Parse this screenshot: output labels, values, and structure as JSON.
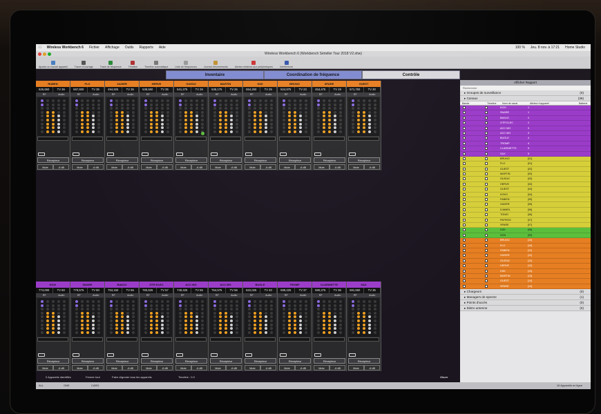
{
  "menubar": {
    "app": "Wireless Workbench 6",
    "items": [
      "Fichier",
      "Affichage",
      "Outils",
      "Rapports",
      "Aide"
    ],
    "clock": "Jeu. 8 nov. à 17:21",
    "battery": "100 %",
    "user": "Home Studio"
  },
  "window": {
    "title": "Wireless Workbench 6 (Workbench Sérieller Tour 2018 V2.shw)"
  },
  "toolbar": [
    {
      "label": "Ajouter un nouvel appareil",
      "color": "#4a7fc0"
    },
    {
      "label": "Tracer d'ouvrage",
      "color": "#555"
    },
    {
      "label": "Tracé de fréquence",
      "color": "#2a8a3a"
    },
    {
      "label": "Timeline",
      "color": "#b03030"
    },
    {
      "label": "Timeline automatique",
      "color": "#777"
    },
    {
      "label": "Liste de fréquences",
      "color": "#999"
    },
    {
      "label": "Journal d'événements",
      "color": "#c09030"
    },
    {
      "label": "Alertes relatives aux périphériques",
      "color": "#cc3333"
    },
    {
      "label": "Interférence",
      "color": "#3355aa"
    }
  ],
  "tabs": [
    {
      "label": "Inventaire",
      "color": "#7f8ad0"
    },
    {
      "label": "Coordination de fréquence",
      "color": "#7f8ad0"
    },
    {
      "label": "Contrôle",
      "color": "#d8d8dc"
    }
  ],
  "colors": {
    "orange": "#e67e22",
    "purple": "#9b3cc9",
    "yellow": "#d6cf3a",
    "green": "#5cbf3c",
    "amber": "#f0a020"
  },
  "top_bank": [
    {
      "name": "RUBEN",
      "freq": "626,650",
      "tv": "TV 36"
    },
    {
      "name": "FLO",
      "freq": "587,600",
      "tv": "TV 35"
    },
    {
      "name": "XAVIER",
      "freq": "494,925",
      "tv": "TV 35"
    },
    {
      "name": "HERVE",
      "freq": "538,550",
      "tv": "TV 35"
    },
    {
      "name": "GUIGUI",
      "freq": "541,275",
      "tv": "TV 26"
    },
    {
      "name": "MARTIN",
      "freq": "536,175",
      "tv": "TV 25"
    },
    {
      "name": "DIDI",
      "freq": "554,250",
      "tv": "TV 25"
    },
    {
      "name": "BRUNO",
      "freq": "524,975",
      "tv": "TV 23"
    },
    {
      "name": "SPARE",
      "freq": "454,475",
      "tv": "TV 19"
    },
    {
      "name": "GUEST",
      "freq": "571,750",
      "tv": "TV 30"
    }
  ],
  "bottom_bank": [
    {
      "name": "KICK",
      "freq": "774,000",
      "tv": "TV 60"
    },
    {
      "name": "SNARE",
      "freq": "778,575",
      "tv": "TV 60"
    },
    {
      "name": "BANJO",
      "freq": "753,150",
      "tv": "TV 56"
    },
    {
      "name": "GTR ELEC",
      "freq": "760,625",
      "tv": "TV 57"
    },
    {
      "name": "ACC MG",
      "freq": "749,425",
      "tv": "TV 55"
    },
    {
      "name": "ACC MG",
      "freq": "754,575",
      "tv": "TV 56"
    },
    {
      "name": "BUGLE",
      "freq": "622,025",
      "tv": "TV 40"
    },
    {
      "name": "TROMP",
      "freq": "599,225",
      "tv": "TV 37"
    },
    {
      "name": "CLARINETTE",
      "freq": "590,275",
      "tv": "TV 36"
    },
    {
      "name": "SAX",
      "freq": "581,550",
      "tv": "TV 35"
    }
  ],
  "channel_labels": {
    "rf": "RF",
    "audio": "Audio",
    "receiver": "Récepteur",
    "mute": "Mute",
    "gain": "-6 dB"
  },
  "right_panel": {
    "title": "Afficher Rapport",
    "search": "Rechercher",
    "groups_top": [
      {
        "label": "Groupes de surveillance",
        "count": "(0)"
      },
      {
        "label": "Canaux",
        "count": "(36)"
      }
    ],
    "columns": [
      "Bande",
      "Timeline",
      "Nom de canal",
      "Attribut d'appareil",
      "Batterie"
    ],
    "rows": [
      {
        "name": "KICK",
        "group": "1",
        "color": "purple"
      },
      {
        "name": "SNARE",
        "group": "1",
        "color": "purple"
      },
      {
        "name": "BANJO",
        "group": "2",
        "color": "purple"
      },
      {
        "name": "GTR ELEC",
        "group": "2",
        "color": "purple"
      },
      {
        "name": "ACC MG",
        "group": "3",
        "color": "purple"
      },
      {
        "name": "ACC MG",
        "group": "3",
        "color": "purple"
      },
      {
        "name": "BUGLE",
        "group": "4",
        "color": "purple"
      },
      {
        "name": "TROMP",
        "group": "4",
        "color": "purple"
      },
      {
        "name": "CLARINETTE",
        "group": "5",
        "color": "purple"
      },
      {
        "name": "SAX",
        "group": "5",
        "color": "purple"
      },
      {
        "name": "BRUNO",
        "group": "[01]",
        "color": "yellow"
      },
      {
        "name": "FLO",
        "group": "[01]",
        "color": "yellow"
      },
      {
        "name": "GUEST",
        "group": "[02]",
        "color": "yellow"
      },
      {
        "name": "MARTIN",
        "group": "[02]",
        "color": "yellow"
      },
      {
        "name": "GUIGUI",
        "group": "[03]",
        "color": "yellow"
      },
      {
        "name": "HERVE",
        "group": "[03]",
        "color": "yellow"
      },
      {
        "name": "GUEST",
        "group": "[04]",
        "color": "yellow"
      },
      {
        "name": "KOKO",
        "group": "[04]",
        "color": "yellow"
      },
      {
        "name": "FABIEN",
        "group": "[05]",
        "color": "yellow"
      },
      {
        "name": "XAVIER",
        "group": "[05]",
        "color": "yellow"
      },
      {
        "name": "DJAMEL",
        "group": "[06]",
        "color": "yellow"
      },
      {
        "name": "TONIO",
        "group": "[06]",
        "color": "yellow"
      },
      {
        "name": "PATRICK",
        "group": "[07]",
        "color": "yellow"
      },
      {
        "name": "SPARE",
        "group": "[07]",
        "color": "yellow"
      },
      {
        "name": "DIDI",
        "group": "[08]",
        "color": "green"
      },
      {
        "name": "SON",
        "group": "[09]",
        "color": "green"
      },
      {
        "name": "BRUNO",
        "group": "[10]",
        "color": "orange"
      },
      {
        "name": "FLO",
        "group": "[10]",
        "color": "orange"
      },
      {
        "name": "FABIEN",
        "group": "[11]",
        "color": "orange"
      },
      {
        "name": "XAVIER",
        "group": "[11]",
        "color": "orange"
      },
      {
        "name": "GUIGUI",
        "group": "[12]",
        "color": "orange"
      },
      {
        "name": "HERVE",
        "group": "[12]",
        "color": "orange"
      },
      {
        "name": "DIDI",
        "group": "[13]",
        "color": "orange"
      },
      {
        "name": "MARTIN",
        "group": "[13]",
        "color": "orange"
      },
      {
        "name": "GUEST",
        "group": "[14]",
        "color": "orange"
      },
      {
        "name": "SPARE",
        "group": "[14]",
        "color": "orange"
      }
    ],
    "groups_bottom": [
      {
        "label": "Chargeurs",
        "count": "(0)"
      },
      {
        "label": "Managers de spectre",
        "count": "(1)"
      },
      {
        "label": "Points d'accès",
        "count": "(0)"
      },
      {
        "label": "Distro antenne",
        "count": "(0)"
      }
    ]
  },
  "statusbar": {
    "filter_tabs": [
      "ALL",
      "ONE",
      "CARD"
    ],
    "identified": "0 Appareils identifiés",
    "close_all": "Fermer tout",
    "identify_all": "Faire clignoter tous les appareils",
    "timeline": "Timeline : 0.0",
    "online": "16 Appareils en ligne",
    "brand": "Shure"
  }
}
